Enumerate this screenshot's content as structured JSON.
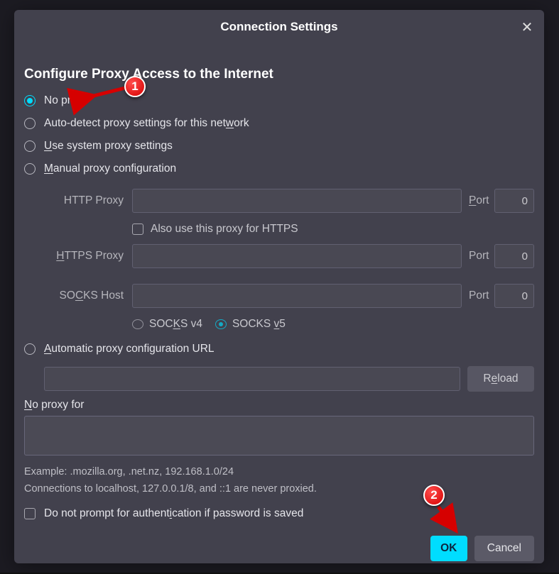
{
  "dialog": {
    "title": "Connection Settings"
  },
  "section_heading": "Configure Proxy Access to the Internet",
  "options": {
    "no_proxy": "No proxy",
    "auto_detect_pre": "Auto-detect proxy settings for this net",
    "auto_detect_u": "w",
    "auto_detect_post": "ork",
    "system_pre": "",
    "system_u": "U",
    "system_post": "se system proxy settings",
    "manual_pre": "",
    "manual_u": "M",
    "manual_post": "anual proxy configuration",
    "pac_pre": "",
    "pac_u": "A",
    "pac_post": "utomatic proxy configuration URL"
  },
  "fields": {
    "http_label": "HTTP Proxy",
    "https_label_pre": "",
    "https_label_u": "H",
    "https_label_post": "TTPS Proxy",
    "socks_label_pre": "SO",
    "socks_label_u": "C",
    "socks_label_post": "KS Host",
    "port_label_pre": "",
    "port_label_u": "P",
    "port_label_post": "ort",
    "port_plain": "Port",
    "http_value": "",
    "http_port": "0",
    "https_value": "",
    "https_port": "0",
    "socks_value": "",
    "socks_port": "0",
    "also_https": "Also use this proxy for HTTPS",
    "socks_v4_pre": "SOC",
    "socks_v4_u": "K",
    "socks_v4_post": "S v4",
    "socks_v5_pre": "SOCKS ",
    "socks_v5_u": "v",
    "socks_v5_post": "5",
    "pac_value": "",
    "reload_pre": "R",
    "reload_u": "e",
    "reload_post": "load"
  },
  "no_proxy_for": {
    "label_pre": "",
    "label_u": "N",
    "label_post": "o proxy for",
    "value": "",
    "example": "Example: .mozilla.org, .net.nz, 192.168.1.0/24",
    "note": "Connections to localhost, 127.0.0.1/8, and ::1 are never proxied."
  },
  "auth": {
    "label_pre": "Do not prompt for authent",
    "label_u": "i",
    "label_post": "cation if password is saved"
  },
  "buttons": {
    "ok": "OK",
    "cancel": "Cancel"
  },
  "annotations": {
    "marker1": "1",
    "marker2": "2"
  }
}
